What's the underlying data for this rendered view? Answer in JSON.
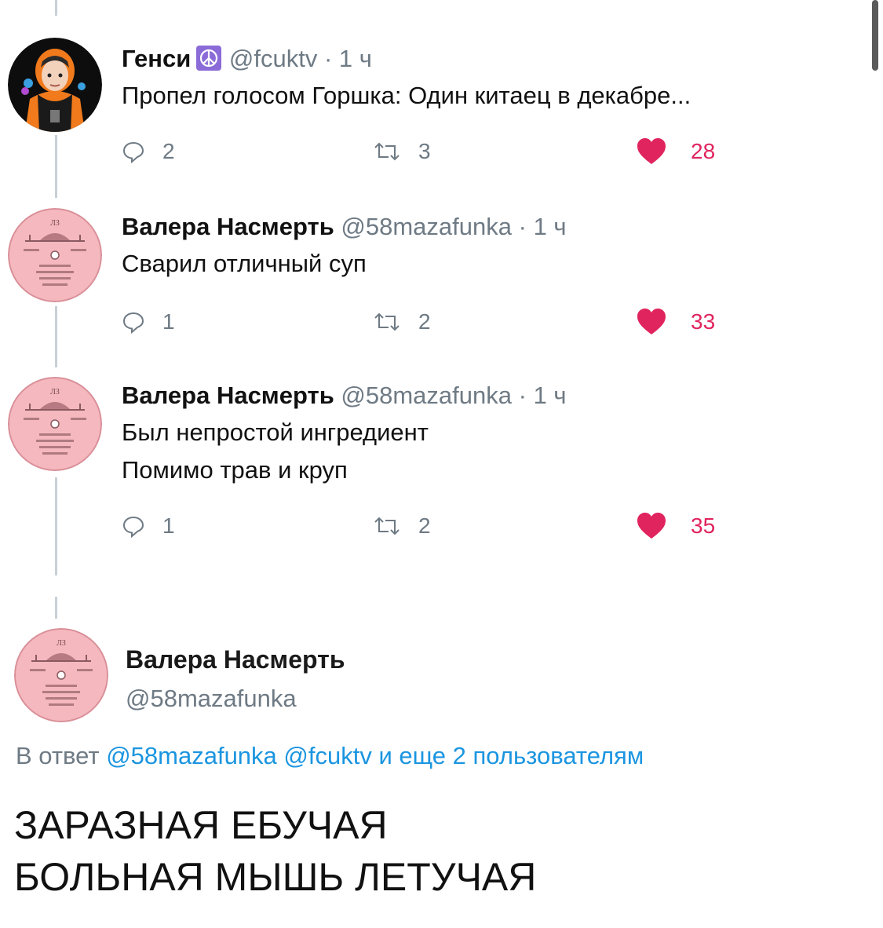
{
  "tweets": [
    {
      "name": "Генси",
      "badge": "peace-sign-icon",
      "handle": "@fcuktv",
      "dot": "·",
      "time": "1 ч",
      "text_lines": [
        "Пропел голосом Горшка: Один китаец в декабре..."
      ],
      "replies": "2",
      "retweets": "3",
      "likes": "28"
    },
    {
      "name": "Валера Насмерть",
      "handle": "@58mazafunka",
      "dot": "·",
      "time": "1 ч",
      "text_lines": [
        "Сварил отличный суп"
      ],
      "replies": "1",
      "retweets": "2",
      "likes": "33"
    },
    {
      "name": "Валера Насмерть",
      "handle": "@58mazafunka",
      "dot": "·",
      "time": "1 ч",
      "text_lines": [
        "Был непростой ингредиент",
        "Помимо трав и круп"
      ],
      "replies": "1",
      "retweets": "2",
      "likes": "35"
    }
  ],
  "main_tweet": {
    "name": "Валера Насмерть",
    "handle": "@58mazafunka",
    "reply_prefix": "В ответ",
    "reply_user_1": "@58mazafunka",
    "reply_user_2": "@fcuktv",
    "reply_suffix": "и еще 2 пользователям",
    "text_lines": [
      "ЗАРАЗНАЯ ЕБУЧАЯ",
      "БОЛЬНАЯ МЫШЬ ЛЕТУЧАЯ"
    ]
  },
  "colors": {
    "like": "#e0245e",
    "link": "#1b95e0",
    "muted": "#6e7a84",
    "thread_line": "#c8d0d6",
    "record_label": "#f4b8be"
  }
}
